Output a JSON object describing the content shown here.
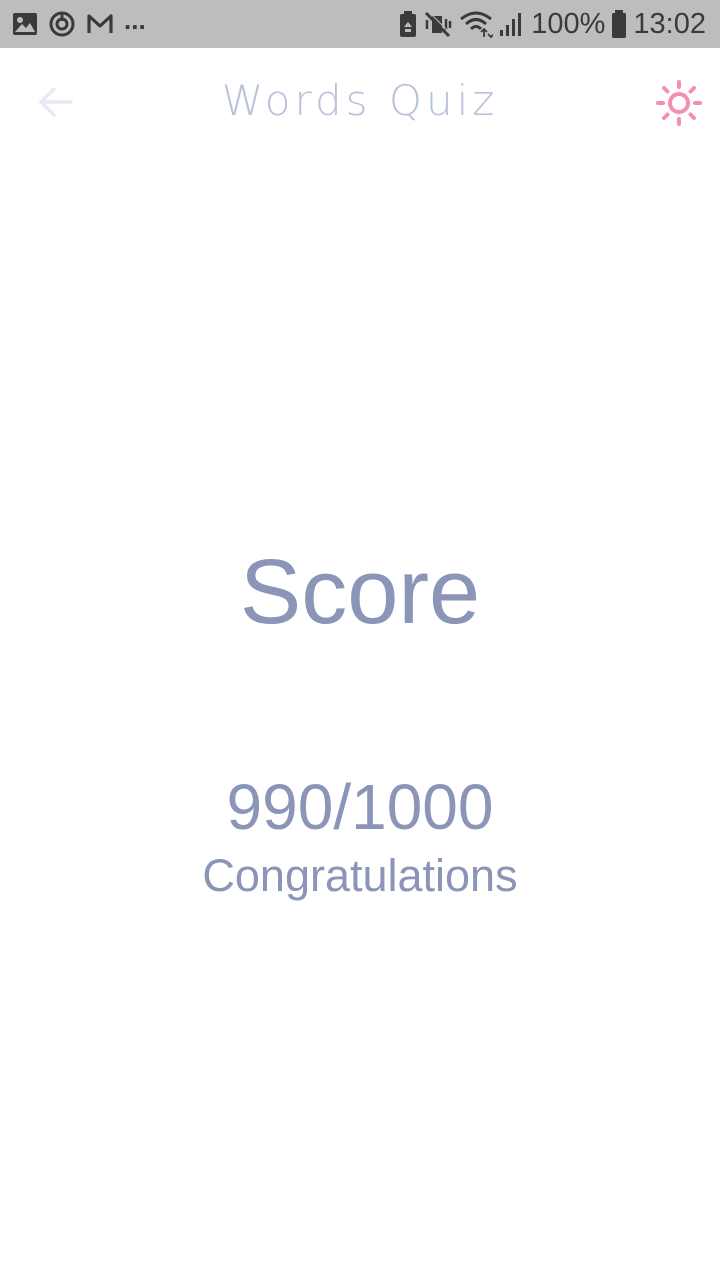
{
  "status_bar": {
    "notification_icons": [
      "gallery-icon",
      "sync-icon",
      "mail-icon"
    ],
    "overflow": "...",
    "system_icons": [
      "recycle-battery-icon",
      "mute-icon",
      "wifi-icon",
      "signal-icon",
      "battery-icon"
    ],
    "battery_percent": "100%",
    "time": "13:02"
  },
  "app_bar": {
    "back_icon": "arrow-left-icon",
    "title": "Words Quiz",
    "theme_icon": "sun-icon"
  },
  "result": {
    "heading": "Score",
    "score": "990/1000",
    "message": "Congratulations"
  },
  "colors": {
    "status_bar_bg": "#bdbdbd",
    "title": "#b8c2d8",
    "text": "#8a95b8",
    "accent": "#f48fb1",
    "back_arrow": "#e6eaf3"
  }
}
